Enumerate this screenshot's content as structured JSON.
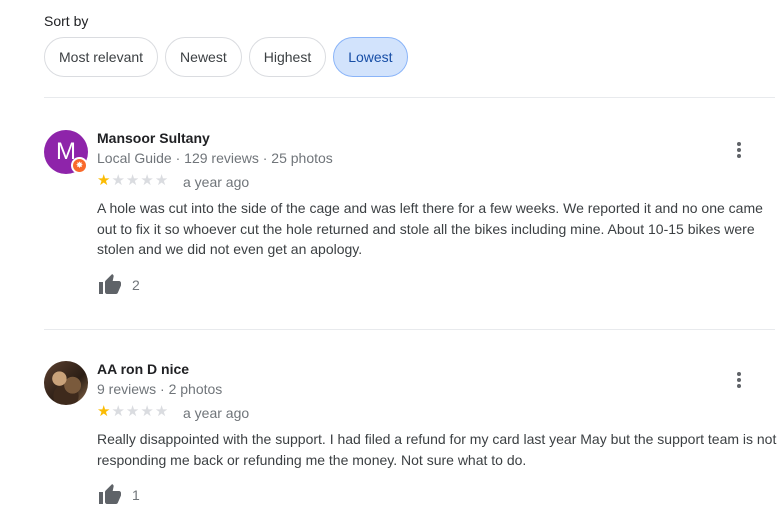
{
  "sort": {
    "label": "Sort by",
    "options": [
      "Most relevant",
      "Newest",
      "Highest",
      "Lowest"
    ],
    "selected": "Lowest"
  },
  "reviews": [
    {
      "name": "Mansoor Sultany",
      "avatar_letter": "M",
      "meta": "Local Guide · 129 reviews · 25 photos",
      "rating": 1,
      "max_rating": 5,
      "date": "a year ago",
      "text": "A hole was cut into the side of the cage and was left there for a few weeks. We reported it and no one came out to fix it so whoever cut the hole returned and stole all the bikes including mine. About 10-15 bikes were stolen and we did not even get an apology.",
      "likes": "2"
    },
    {
      "name": "AA ron D nice",
      "meta": "9 reviews · 2 photos",
      "rating": 1,
      "max_rating": 5,
      "date": "a year ago",
      "text": "Really disappointed with the support. I had filed a refund for my card last year May but the support team is not responding me back or refunding me the money. Not sure what to do.",
      "likes": "1"
    }
  ],
  "colors": {
    "star_filled": "#fbbc04",
    "star_empty": "#dadce0",
    "chip_active_bg": "#d2e3fc",
    "local_guide_badge": "#f96a2b",
    "avatar_bg": "#8e24aa"
  }
}
